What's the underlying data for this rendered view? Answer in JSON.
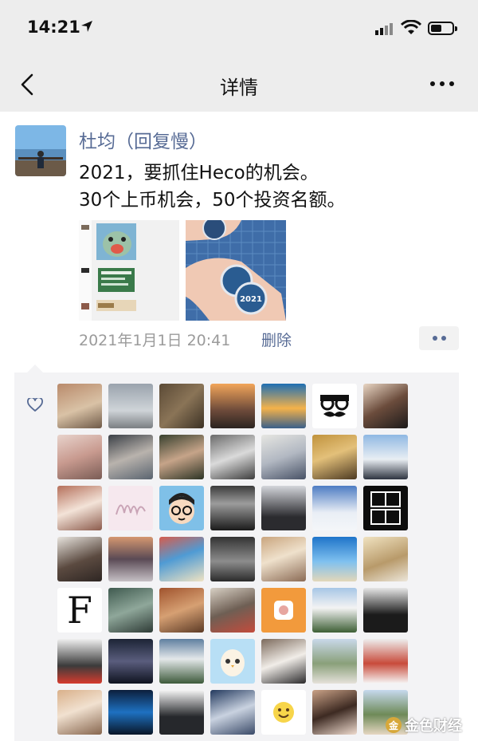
{
  "status_bar": {
    "time": "14:21"
  },
  "nav": {
    "title": "详情"
  },
  "post": {
    "author": "杜均（回复慢）",
    "lines": [
      "2021，要抓住Heco的机会。",
      "30个上币机会，50个投资名额。"
    ],
    "photo2_text": "2021",
    "timestamp": "2021年1月1日 20:41",
    "delete_label": "删除"
  },
  "likes": {
    "cells": [
      {
        "bg": "linear-gradient(160deg,#b98a6b,#d9c2a6 55%,#6f5a48)"
      },
      {
        "bg": "linear-gradient(180deg,#9aa3ad,#cfd4d8 60%,#7b7f83)"
      },
      {
        "bg": "linear-gradient(135deg,#5b4a36,#8a7457 50%,#3c3124)"
      },
      {
        "bg": "linear-gradient(180deg,#f2a55a,#6d4a3a 60%,#2b2420)"
      },
      {
        "bg": "linear-gradient(180deg,#1f6fb3,#f4b24a 55%,#3a5f8a)"
      },
      {
        "bg": "#ffffff",
        "glyph": "specs"
      },
      {
        "bg": "linear-gradient(150deg,#e9d6c4,#6b4c3c 50%,#1c1a1a)"
      },
      {
        "bg": "linear-gradient(160deg,#e8d3cc,#c89a8f 50%,#7a5c55)"
      },
      {
        "bg": "linear-gradient(160deg,#3a3f46,#b9b3ad 50%,#5a6470)"
      },
      {
        "bg": "linear-gradient(160deg,#37402e,#c6a489 50%,#2d3425)"
      },
      {
        "bg": "linear-gradient(160deg,#6b6b6b,#dadada 50%,#3d3d3d)"
      },
      {
        "bg": "linear-gradient(160deg,#e6e6e2,#b2b8c2 50%,#485266)"
      },
      {
        "bg": "linear-gradient(160deg,#c0923c,#e3c07a 45%,#4d3a22)"
      },
      {
        "bg": "linear-gradient(180deg,#8fb8e3,#e9eef3 55%,#2e3440)"
      },
      {
        "bg": "linear-gradient(160deg,#b5705b,#f3e3d8 50%,#8c5b4c)"
      },
      {
        "bg": "#f6e8ee",
        "glyph": "sig"
      },
      {
        "bg": "#7fc0e8",
        "glyph": "cartoon"
      },
      {
        "bg": "linear-gradient(180deg,#3b3b3b,#9c9c9c 40%,#1a1a1a)"
      },
      {
        "bg": "linear-gradient(180deg,#d4d6db,#2b2b2f 70%)"
      },
      {
        "bg": "linear-gradient(180deg,#4d7cc3,#e9eef5 60%,#f4f6f9)"
      },
      {
        "bg": "#0d0d0d",
        "glyph": "cjk"
      },
      {
        "bg": "linear-gradient(160deg,#e7e3dd,#5b4a40 55%,#2e2623)"
      },
      {
        "bg": "linear-gradient(180deg,#d59770,#5a4a55 50%,#c6c0c5)"
      },
      {
        "bg": "linear-gradient(160deg,#d75c4c,#4f9bd4 45%,#f0e3c2)"
      },
      {
        "bg": "linear-gradient(180deg,#333,#8d8d8d 55%,#2a2a2a)"
      },
      {
        "bg": "linear-gradient(160deg,#c9a57e,#efe1cc 45%,#8b6b55)"
      },
      {
        "bg": "linear-gradient(180deg,#1f74c9,#7ec0ef 55%,#e3d7b9)"
      },
      {
        "bg": "linear-gradient(160deg,#f0e2c0,#b89a6a 55%,#ece6da)"
      },
      {
        "bg": "#ffffff",
        "glyph": "F"
      },
      {
        "bg": "linear-gradient(160deg,#3f5a4f,#8fa79a 50%,#2e3b36)"
      },
      {
        "bg": "linear-gradient(160deg,#a0532d,#d6a073 50%,#5c3a25)"
      },
      {
        "bg": "linear-gradient(160deg,#d8d0c4,#6e5f54 50%,#c44b3c)"
      },
      {
        "bg": "#f29a3c",
        "glyph": "bubble"
      },
      {
        "bg": "linear-gradient(180deg,#a7c6e6,#f3f3f3 45%,#3d5f35)"
      },
      {
        "bg": "linear-gradient(180deg,#e6e6e6,#1b1b1b 60%)"
      },
      {
        "bg": "linear-gradient(180deg,#f0f0f0,#3b3b3b 60%,#d63b2e)"
      },
      {
        "bg": "linear-gradient(180deg,#1c2436,#5a5d7d 50%,#0f1320)"
      },
      {
        "bg": "linear-gradient(180deg,#5f7fa0,#e4e8ea 45%,#3d5a3b)"
      },
      {
        "bg": "#b8dff5",
        "glyph": "egg"
      },
      {
        "bg": "linear-gradient(160deg,#7c6a5c,#f1ede8 50%,#2b2a2c)"
      },
      {
        "bg": "linear-gradient(180deg,#c9d9ea,#8aa07a 55%,#e5e1da)"
      },
      {
        "bg": "linear-gradient(180deg,#eeeeee,#c84b3b 55%,#f6f6f6)"
      },
      {
        "bg": "linear-gradient(160deg,#d9b08a,#f1e1d0 45%,#87664e)"
      },
      {
        "bg": "linear-gradient(180deg,#0c1f3c,#1e71c1 50%,#0a1628)"
      },
      {
        "bg": "linear-gradient(180deg,#f5f5f5,#26282c 60%)"
      },
      {
        "bg": "linear-gradient(160deg,#23395e,#c9d2e0 50%,#3a4a68)"
      },
      {
        "bg": "#ffffff",
        "glyph": "smile"
      },
      {
        "bg": "linear-gradient(160deg,#caa287,#3d2a22 50%,#f0dccf)"
      },
      {
        "bg": "linear-gradient(180deg,#c6d9ee,#6e8a58 55%,#e6d7c2)"
      }
    ]
  },
  "watermark": {
    "text": "金色财经"
  }
}
